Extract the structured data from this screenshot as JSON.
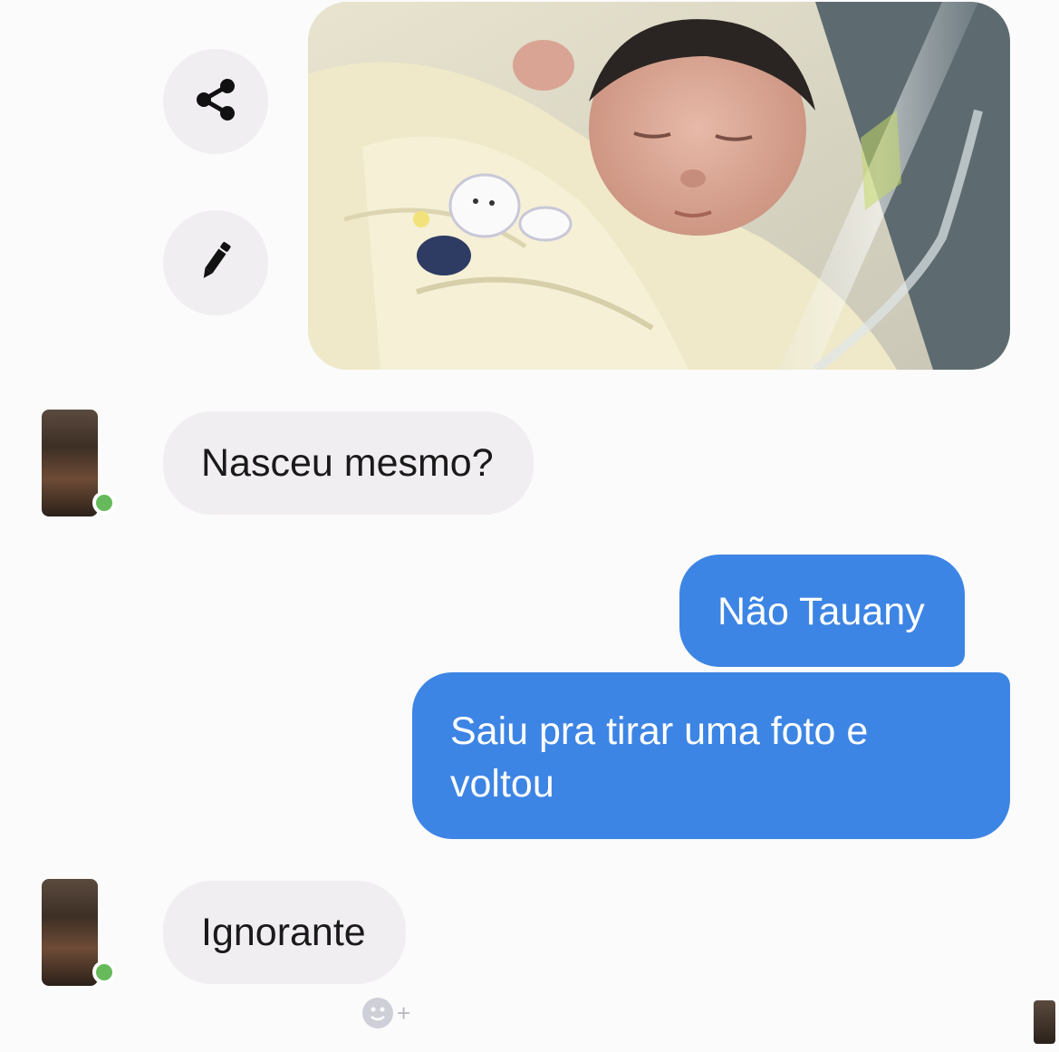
{
  "chat": {
    "messages": [
      {
        "from": "other",
        "text": "Nasceu mesmo?"
      },
      {
        "from": "me",
        "text": "Não Tauany"
      },
      {
        "from": "me",
        "text": "Saiu pra tirar uma foto e\nvoltou"
      },
      {
        "from": "other",
        "text": "Ignorante"
      }
    ],
    "reaction_add": "+"
  },
  "icons": {
    "share": "share-icon",
    "edit": "pencil-icon",
    "emoji": "emoji-icon"
  },
  "colors": {
    "outgoing_bubble": "#3d85e4",
    "incoming_bubble": "#f1eef1",
    "online_dot": "#67ba5b",
    "background": "#fbfbfb"
  }
}
